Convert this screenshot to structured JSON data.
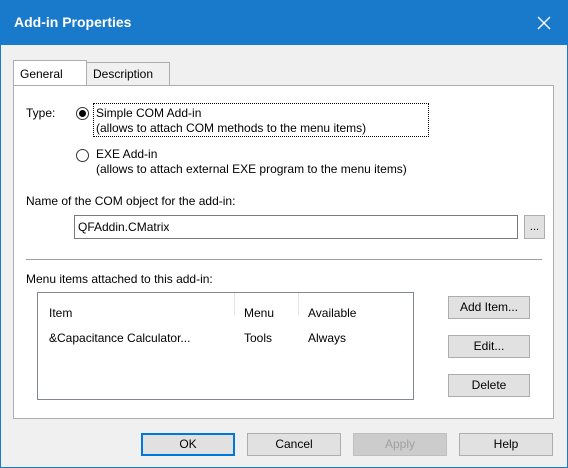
{
  "window": {
    "title": "Add-in Properties"
  },
  "tabs": [
    {
      "label": "General",
      "active": true
    },
    {
      "label": "Description",
      "active": false
    }
  ],
  "type_section": {
    "label": "Type:",
    "options": [
      {
        "title": "Simple COM Add-in",
        "desc": "(allows to attach COM methods to the menu items)",
        "selected": true
      },
      {
        "title": "EXE Add-in",
        "desc": "(allows to attach external EXE program to the menu items)",
        "selected": false
      }
    ]
  },
  "com_object": {
    "label": "Name of the COM object for the add-in:",
    "value": "QFAddin.CMatrix",
    "browse_label": "..."
  },
  "menu_items": {
    "label": "Menu items attached to this add-in:",
    "columns": [
      "Item",
      "Menu",
      "Available"
    ],
    "rows": [
      {
        "item": "&Capacitance Calculator...",
        "menu": "Tools",
        "available": "Always"
      }
    ]
  },
  "side_buttons": {
    "add": "Add Item...",
    "edit": "Edit...",
    "delete": "Delete"
  },
  "footer_buttons": {
    "ok": "OK",
    "cancel": "Cancel",
    "apply": "Apply",
    "help": "Help"
  },
  "colors": {
    "titlebar": "#1979ca",
    "default_button_border": "#0078d7"
  }
}
